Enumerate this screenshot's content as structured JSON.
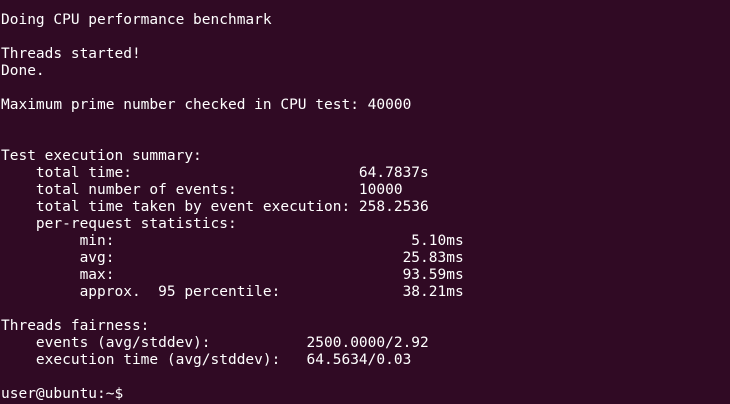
{
  "terminal": {
    "background": "#300a24",
    "foreground": "#ffffff",
    "lines": [
      "Doing CPU performance benchmark",
      "",
      "Threads started!",
      "Done.",
      "",
      "Maximum prime number checked in CPU test: 40000",
      "",
      "",
      "Test execution summary:",
      "    total time:                          64.7837s",
      "    total number of events:              10000",
      "    total time taken by event execution: 258.2536",
      "    per-request statistics:",
      "         min:                                  5.10ms",
      "         avg:                                 25.83ms",
      "         max:                                 93.59ms",
      "         approx.  95 percentile:              38.21ms",
      "",
      "Threads fairness:",
      "    events (avg/stddev):           2500.0000/2.92",
      "    execution time (avg/stddev):   64.5634/0.03",
      ""
    ],
    "prompt": "user@ubuntu:~$ "
  }
}
